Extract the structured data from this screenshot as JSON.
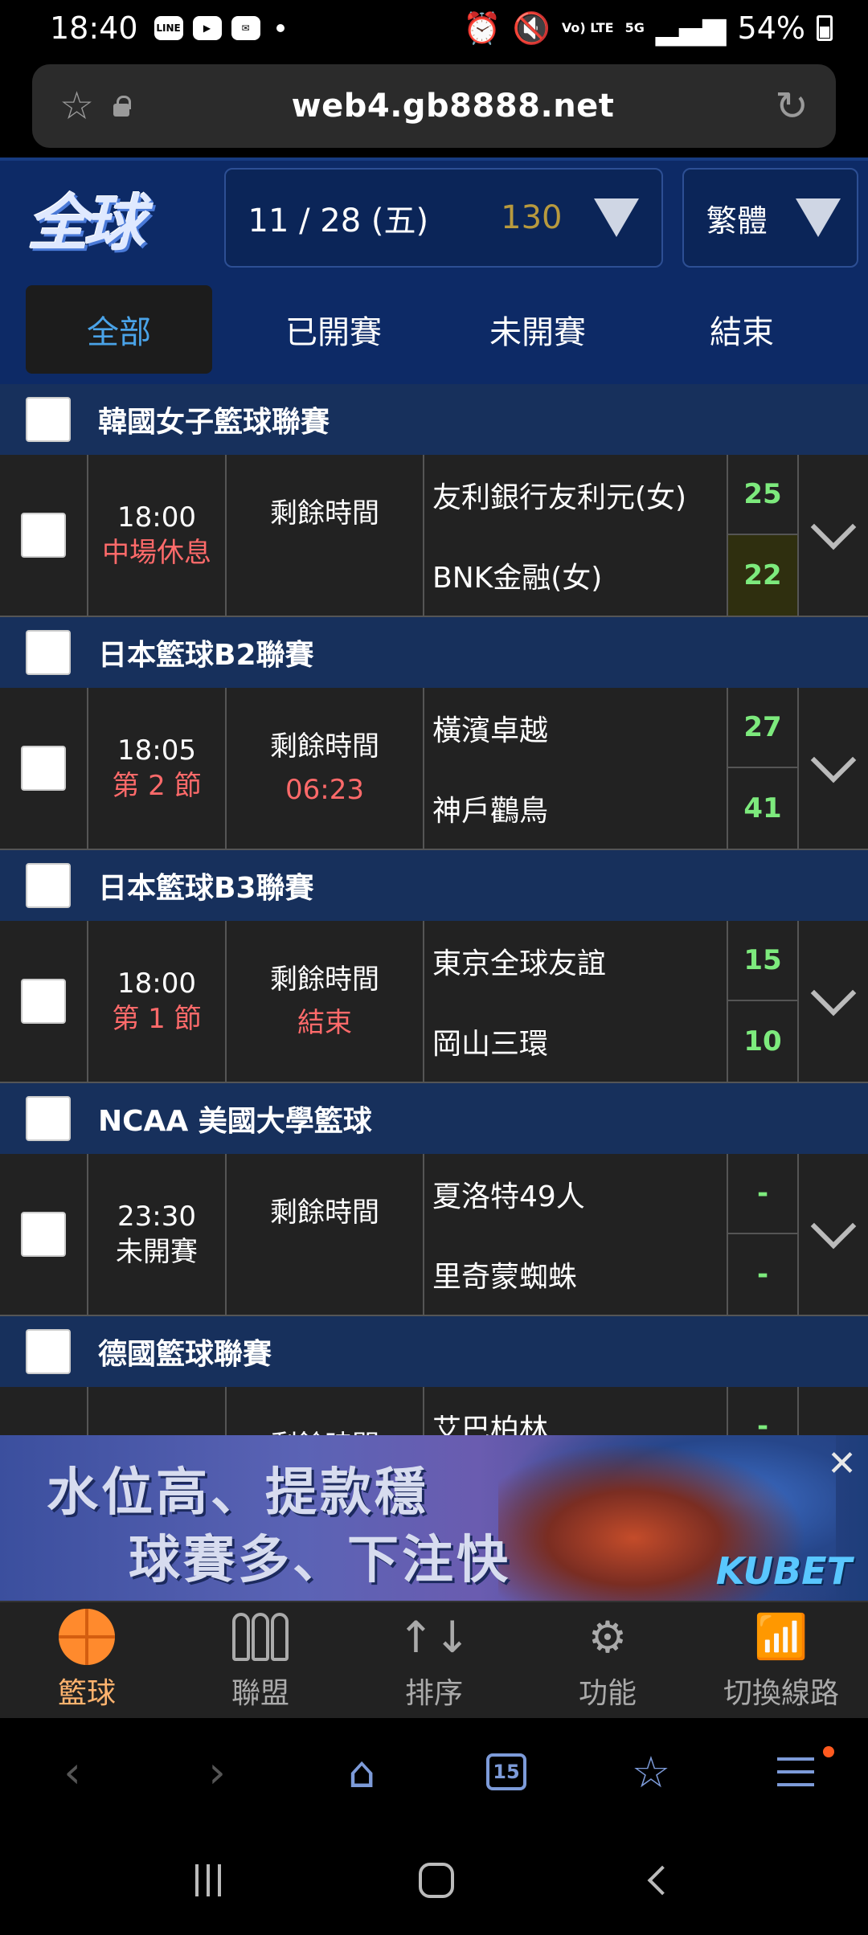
{
  "status_bar": {
    "time": "18:40",
    "app_icons": [
      "LINE",
      "YouTube",
      "Mail"
    ],
    "network_volte": "Vo) LTE",
    "network_5g": "5G",
    "battery": "54%"
  },
  "browser": {
    "url": "web4.gb8888.net",
    "tab_count": "15"
  },
  "header": {
    "logo_text": "全球",
    "date": "11 / 28 (五)",
    "game_count": "130",
    "language": "繁體"
  },
  "tabs": [
    {
      "label": "全部"
    },
    {
      "label": "已開賽"
    },
    {
      "label": "未開賽"
    },
    {
      "label": "結束"
    }
  ],
  "remain_label": "剩餘時間",
  "leagues": [
    {
      "name": "韓國女子籃球聯賽",
      "match": {
        "time": "18:00",
        "status": "中場休息",
        "remain": "",
        "home": "友利銀行友利元(女)",
        "away": "BNK金融(女)",
        "home_score": "25",
        "away_score": "22"
      }
    },
    {
      "name": "日本籃球B2聯賽",
      "match": {
        "time": "18:05",
        "status": "第 2 節",
        "remain": "06:23",
        "home": "橫濱卓越",
        "away": "神戶鸛鳥",
        "home_score": "27",
        "away_score": "41"
      }
    },
    {
      "name": "日本籃球B3聯賽",
      "match": {
        "time": "18:00",
        "status": "第 1 節",
        "remain": "結束",
        "home": "東京全球友誼",
        "away": "岡山三環",
        "home_score": "15",
        "away_score": "10"
      }
    },
    {
      "name": "NCAA 美國大學籃球",
      "match": {
        "time": "23:30",
        "status": "未開賽",
        "remain": "",
        "home": "夏洛特49人",
        "away": "里奇蒙蜘蛛",
        "home_score": "-",
        "away_score": "-"
      }
    },
    {
      "name": "德國籃球聯賽",
      "match": {
        "time": "",
        "status": "",
        "remain": "",
        "home": "艾巴柏林",
        "away": "",
        "home_score": "-",
        "away_score": ""
      }
    }
  ],
  "ad": {
    "line1": "水位高、提款穩",
    "line2": "球賽多、下注快",
    "brand": "KUBET"
  },
  "site_nav": [
    {
      "label": "籃球",
      "icon": "basketball-icon"
    },
    {
      "label": "聯盟",
      "icon": "league-icon"
    },
    {
      "label": "排序",
      "icon": "sort-icon"
    },
    {
      "label": "功能",
      "icon": "gear-icon"
    },
    {
      "label": "切換線路",
      "icon": "wifi-icon"
    }
  ],
  "colors": {
    "header_bg": "#0d2a66",
    "league_bg": "#17305c",
    "active_tab_text": "#4aa3e8",
    "score_green": "#7dea7d",
    "status_red": "#ff6a6a",
    "active_nav": "#ffb36e"
  }
}
